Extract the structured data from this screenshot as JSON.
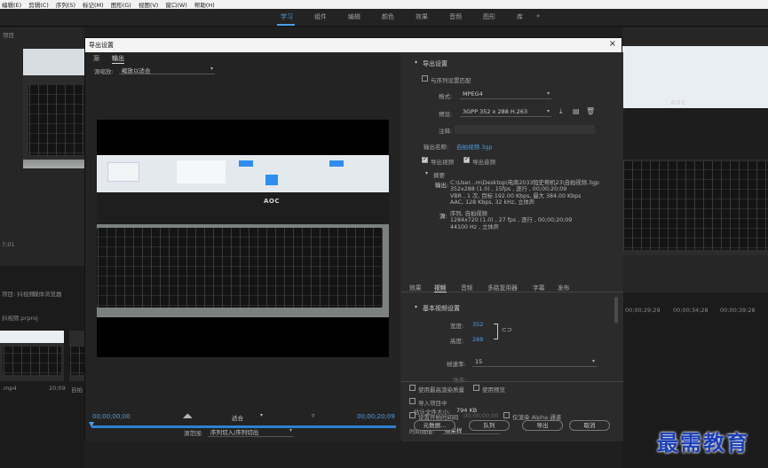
{
  "menu": [
    "编辑(E)",
    "剪辑(C)",
    "序列(S)",
    "标记(M)",
    "图形(G)",
    "视图(V)",
    "窗口(W)",
    "帮助(H)"
  ],
  "workspace_tabs": [
    "学习",
    "组件",
    "编辑",
    "颜色",
    "效果",
    "音频",
    "图形",
    "库"
  ],
  "workspace_more": "»",
  "bg": {
    "top_left_label": "项目",
    "left_timecode": "7;01",
    "left_panel_label": "项目: 抖视频",
    "left_tab2": "媒体浏览器",
    "project_name": "抖视频.prproj",
    "clip1_name": ".mp4",
    "clip1_dur": "20;09",
    "clip2_name": "自拍",
    "right_ticks": [
      "00;00;29;29",
      "00;00;34;28",
      "00;00;39;28"
    ],
    "program_label": "节目: 自拍视频"
  },
  "dialog": {
    "title": "导出设置",
    "close": "×",
    "left_tabs": [
      "源",
      "输出"
    ],
    "scale_label": "源缩放:",
    "scale_value": "缩放以适合",
    "timecode_start": "00;00;00;00",
    "timecode_end": "00;00;20;09",
    "fit_value": "适合",
    "source_range_label": "源范围:",
    "source_range_value": "序列切入/序列切出",
    "export_settings": {
      "heading": "导出设置",
      "match_sequence": "与序列设置匹配",
      "format_label": "格式:",
      "format_value": "MPEG4",
      "preset_label": "预设:",
      "preset_value": "3GPP 352 x 288 H.263",
      "comment_label": "注释:",
      "output_name_label": "输出名称:",
      "output_name_value": "自拍视频.3gp",
      "export_video": "导出视频",
      "export_audio": "导出音频",
      "summary_heading": "摘要",
      "output_label": "输出:",
      "output_lines": [
        "C:\\User...m\\Desktop\\电商2033短史帮机23\\自拍视频.3gp",
        "352x288 (1.0) , 15fps , 逐行 , 00;00;20;09",
        "VBR , 1 次, 目标 192.00 Kbps, 最大 384.00 Kbps",
        "AAC, 128 Kbps, 32  kHz, 立体声"
      ],
      "source_label": "源:",
      "source_lines": [
        "序列, 自拍视频",
        "1284x720 (1.0) , 27 fps , 逐行 , 00;00;20;09",
        "44100 Hz , 立体声"
      ]
    },
    "tabs": [
      "效果",
      "视频",
      "音频",
      "多路复用器",
      "字幕",
      "发布"
    ],
    "basic_video": {
      "heading": "基本视频设置",
      "width_label": "宽度:",
      "width_value": "352",
      "height_label": "高度:",
      "height_value": "288",
      "frame_rate_label": "帧速率:",
      "frame_rate_value": "15",
      "cut_label": "场序:"
    },
    "options": {
      "max_render": "使用最高渲染质量",
      "use_preview": "使用预览",
      "import_project": "导入项目中",
      "set_start_tc": "设置开始时间码",
      "start_tc_value": "00;00;00;00",
      "render_alpha": "仅渲染 Alpha 通道",
      "interp_label": "时间插值:",
      "interp_value": "帧采样",
      "filesize_label": "估计文件大小:",
      "filesize_value": "794 KB"
    },
    "buttons": [
      "元数据...",
      "队列",
      "导出",
      "取消"
    ]
  },
  "photo": {
    "logo": "AOC"
  },
  "watermark": "最需教育"
}
